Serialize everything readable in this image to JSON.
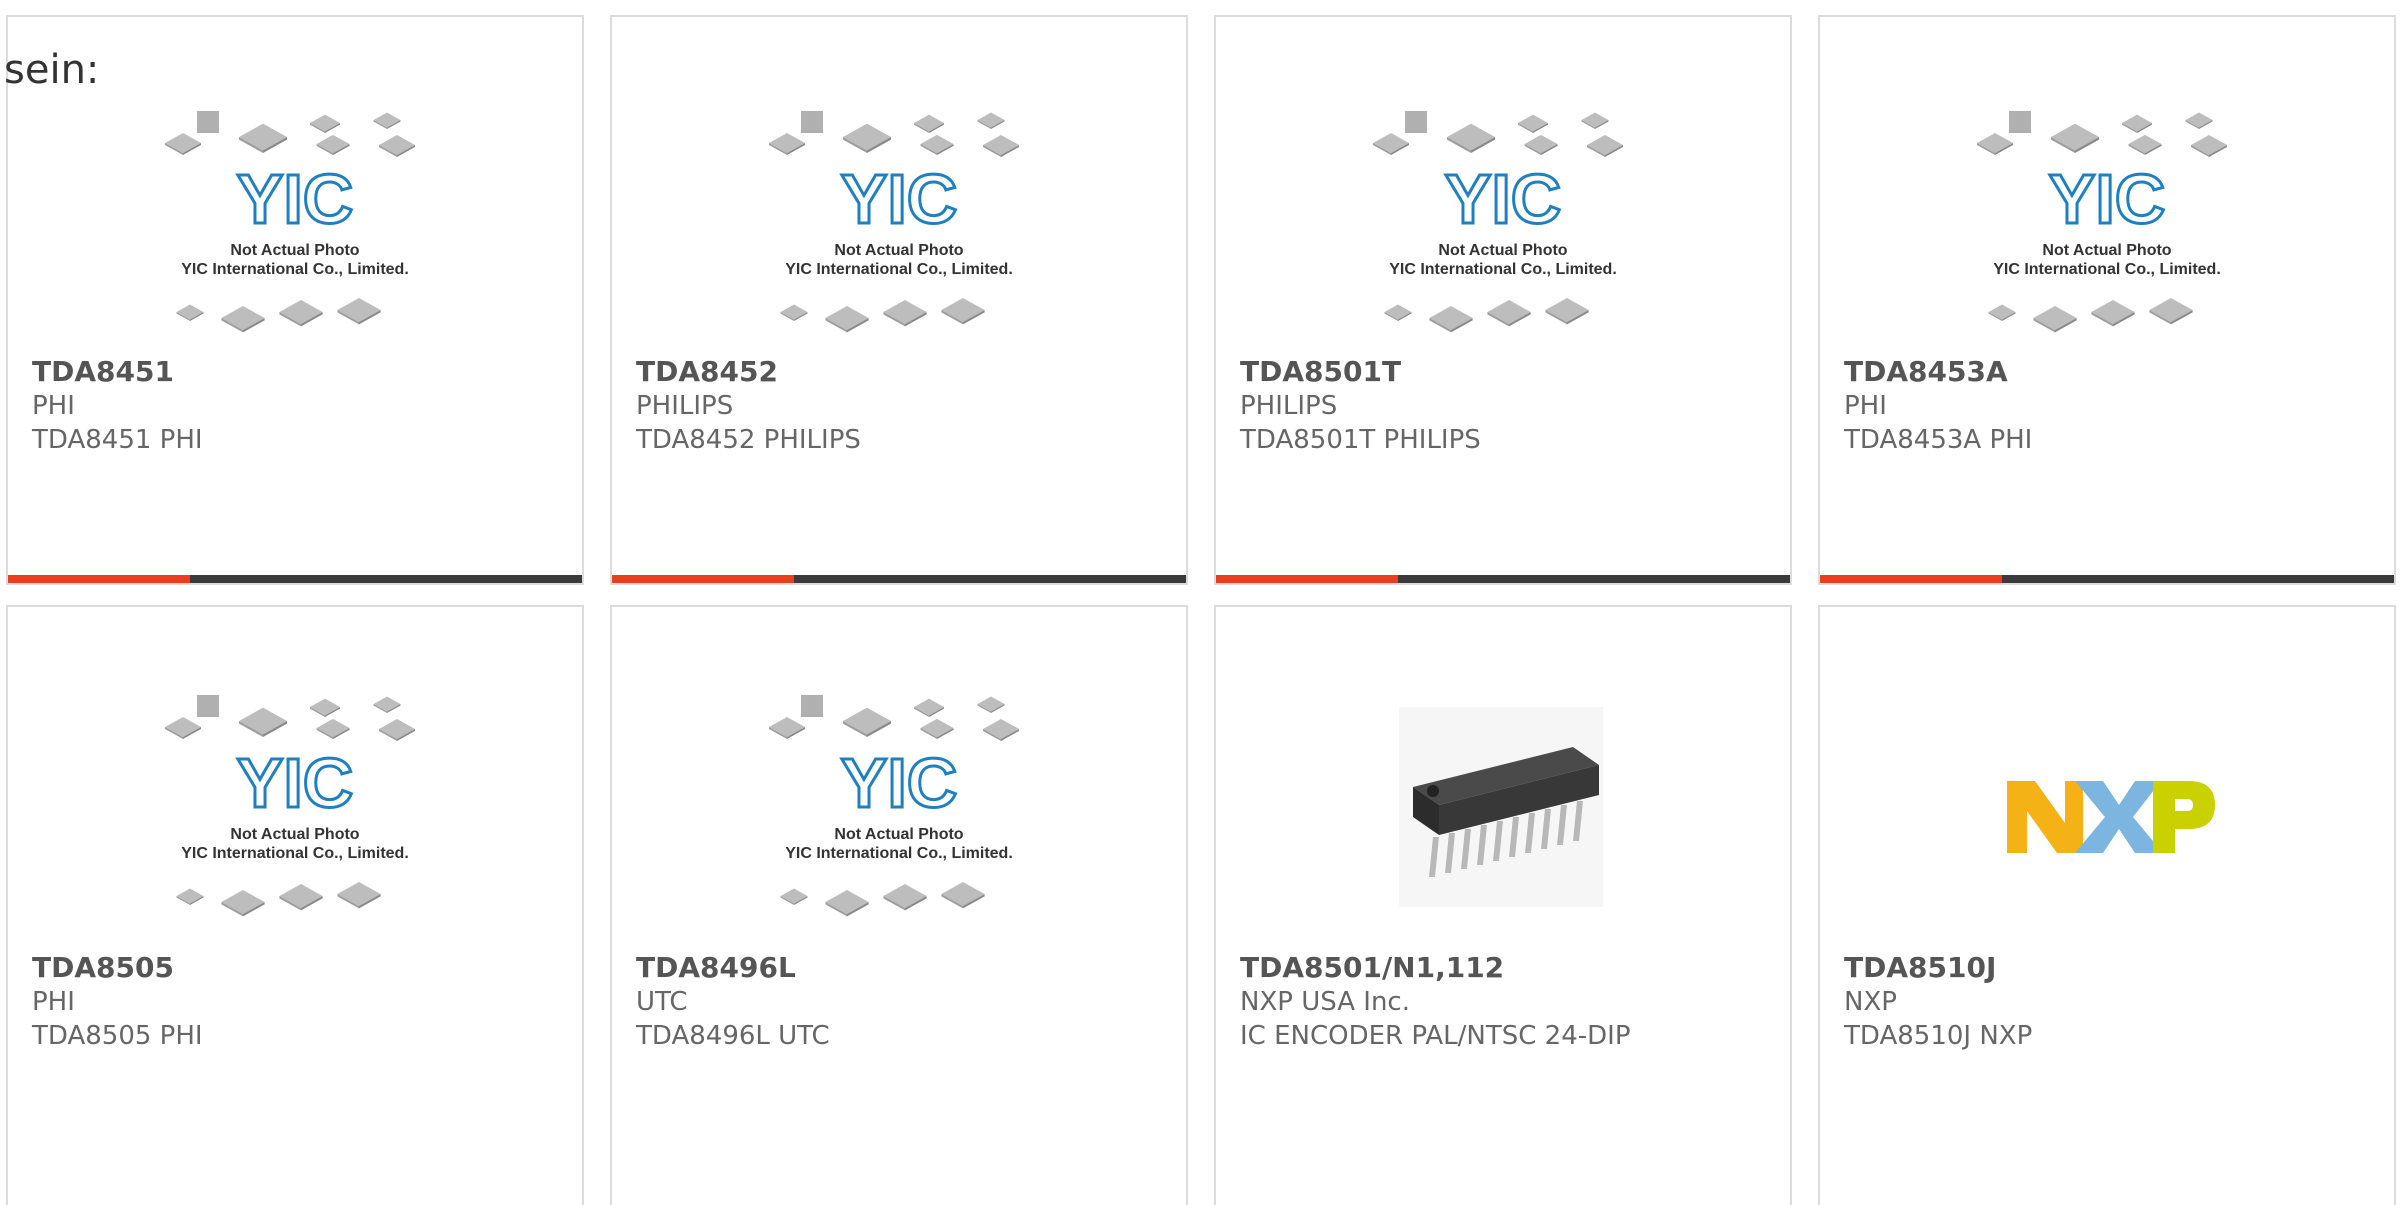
{
  "lead_text": "sein:",
  "placeholder": {
    "line1": "Not Actual Photo",
    "line2": "YIC International Co., Limited.",
    "logo": "YIC"
  },
  "colors": {
    "accent": "#e8401c",
    "bar": "#3a3a3a",
    "border": "#dcdcdc",
    "yic_blue": "#1f7fc1"
  },
  "products": [
    {
      "part": "TDA8451",
      "manufacturer": "PHI",
      "description": "TDA8451 PHI",
      "image": "yic-placeholder"
    },
    {
      "part": "TDA8452",
      "manufacturer": "PHILIPS",
      "description": "TDA8452 PHILIPS",
      "image": "yic-placeholder"
    },
    {
      "part": "TDA8501T",
      "manufacturer": "PHILIPS",
      "description": "TDA8501T PHILIPS",
      "image": "yic-placeholder"
    },
    {
      "part": "TDA8453A",
      "manufacturer": "PHI",
      "description": "TDA8453A PHI",
      "image": "yic-placeholder"
    },
    {
      "part": "TDA8505",
      "manufacturer": "PHI",
      "description": "TDA8505 PHI",
      "image": "yic-placeholder"
    },
    {
      "part": "TDA8496L",
      "manufacturer": "UTC",
      "description": "TDA8496L UTC",
      "image": "yic-placeholder"
    },
    {
      "part": "TDA8501/N1,112",
      "manufacturer": "NXP USA Inc.",
      "description": "IC ENCODER PAL/NTSC 24-DIP",
      "image": "dip-chip-photo"
    },
    {
      "part": "TDA8510J",
      "manufacturer": "NXP",
      "description": "TDA8510J NXP",
      "image": "nxp-logo"
    }
  ]
}
